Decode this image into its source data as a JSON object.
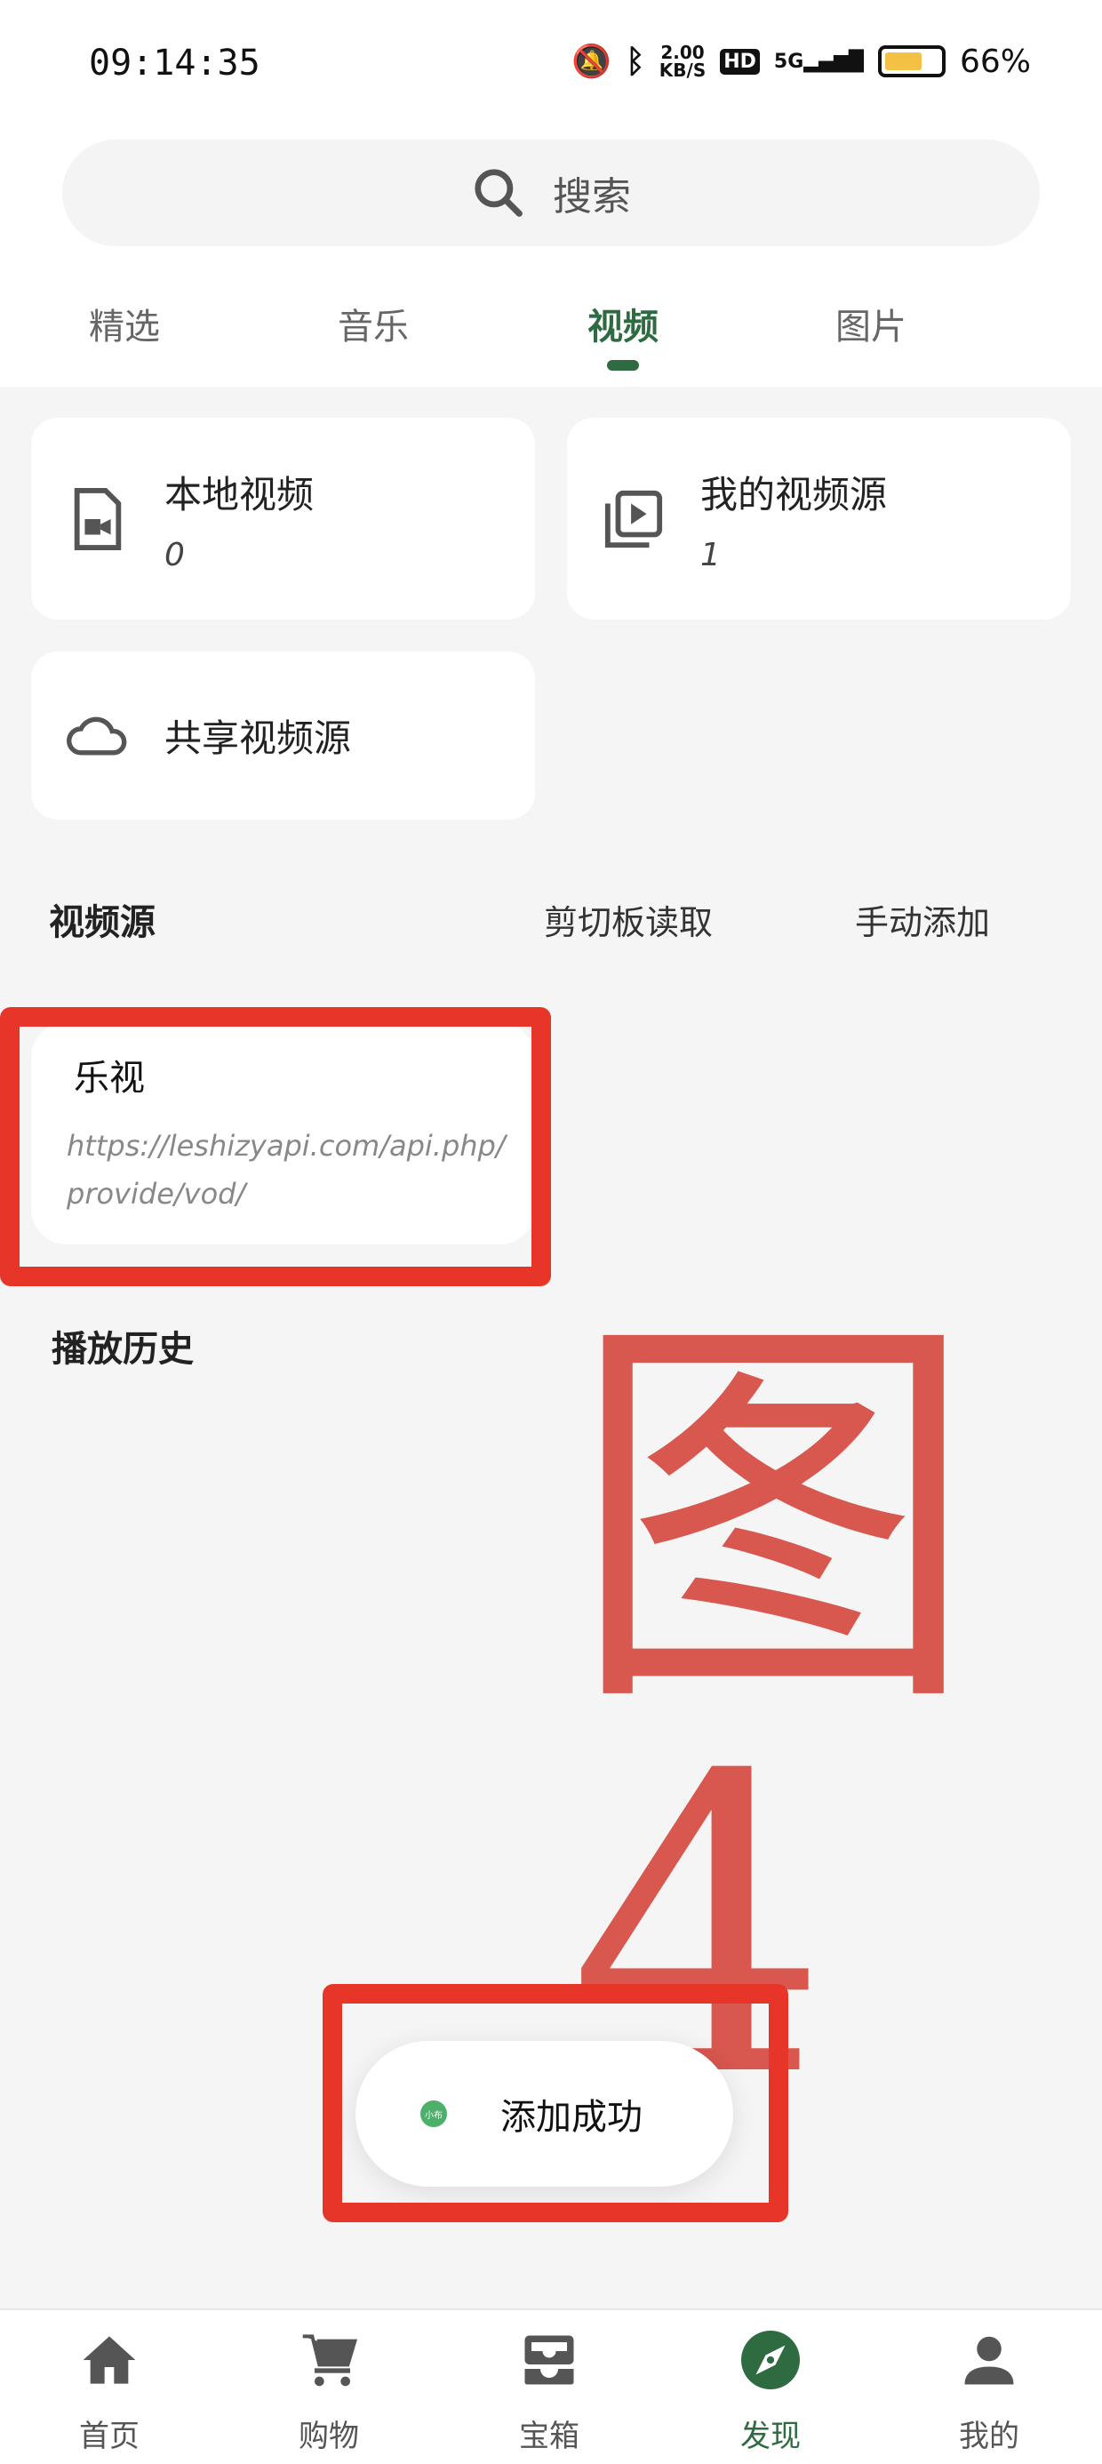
{
  "status_bar": {
    "time": "09:14:35",
    "speed": "2.00",
    "speed_unit": "KB/S",
    "hd": "HD",
    "network": "5G",
    "battery": "66%",
    "battery_level": 0.66
  },
  "search": {
    "placeholder": "搜索",
    "icon": "search-icon"
  },
  "tabs": [
    {
      "label": "精选"
    },
    {
      "label": "音乐"
    },
    {
      "label": "视频",
      "active": true
    },
    {
      "label": "图片"
    }
  ],
  "cards": [
    {
      "title": "本地视频",
      "count": "0",
      "icon": "video-file-icon"
    },
    {
      "title": "我的视频源",
      "count": "1",
      "icon": "video-library-icon"
    },
    {
      "title": "共享视频源",
      "icon": "cloud-icon"
    }
  ],
  "sources_section": {
    "title": "视频源",
    "clipboard_label": "剪切板读取",
    "manual_add_label": "手动添加"
  },
  "sources": [
    {
      "name": "乐视",
      "url": "https://leshizyapi.com/api.php/provide/vod/"
    }
  ],
  "history_section": {
    "title": "播放历史"
  },
  "annotation": {
    "label": "图4",
    "color": "#d5463e"
  },
  "toast": {
    "badge": "小布",
    "message": "添加成功"
  },
  "bottom_nav": [
    {
      "label": "首页",
      "icon": "home-icon"
    },
    {
      "label": "购物",
      "icon": "cart-icon"
    },
    {
      "label": "宝箱",
      "icon": "inbox-icon"
    },
    {
      "label": "发现",
      "icon": "compass-icon",
      "active": true
    },
    {
      "label": "我的",
      "icon": "person-icon"
    }
  ],
  "colors": {
    "accent": "#2e6b40",
    "highlight_box": "#e8352a",
    "background": "#f5f5f5"
  }
}
